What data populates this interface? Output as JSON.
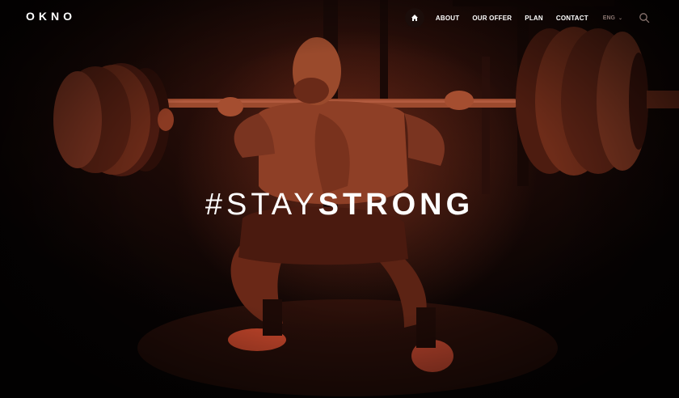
{
  "brand": {
    "logo": "OKNO"
  },
  "nav": {
    "home_icon": "home-icon",
    "items": [
      {
        "label": "ABOUT"
      },
      {
        "label": "OUR OFFER"
      },
      {
        "label": "PLAN"
      },
      {
        "label": "CONTACT"
      }
    ],
    "language": "ENG",
    "search_icon": "search-icon"
  },
  "hero": {
    "headline_light": "#STAY",
    "headline_bold": "STRONG",
    "image": "weightlifter squatting with loaded barbell, red-toned"
  },
  "colors": {
    "accent": "#8f2f1c",
    "text": "#ffffff",
    "background": "#0a0605"
  }
}
